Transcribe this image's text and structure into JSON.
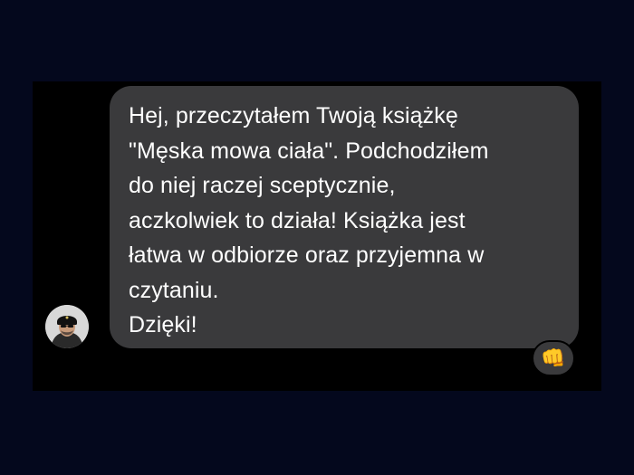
{
  "message": {
    "text": "Hej, przeczytałem Twoją książkę\n\"Męska mowa ciała\". Podchodziłem\ndo niej raczej sceptycznie,\naczkolwiek to działa! Książka jest\nłatwa w odbiorze oraz przyjemna w\nczytaniu.\nDzięki!",
    "reaction_emoji": "👊",
    "avatar_icon": "profile-photo"
  },
  "colors": {
    "page_background": "#04081d",
    "frame_background": "#000000",
    "bubble": "#3a3a3c",
    "text": "#ffffff"
  }
}
